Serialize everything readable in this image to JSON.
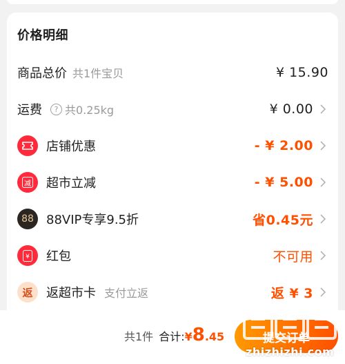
{
  "price_detail": {
    "title": "价格明细",
    "rows": [
      {
        "label": "商品总价",
        "sub": "共1件宝贝",
        "value": "¥ 15.90",
        "value_color": "#1f1f1f",
        "chevron": false,
        "icon": "none"
      },
      {
        "label": "运费",
        "sub": "共0.25kg",
        "help_icon_text": "?",
        "value": "¥ 0.00",
        "value_color": "#1f1f1f",
        "chevron": true,
        "icon": "question-circle-icon"
      },
      {
        "label": "店铺优惠",
        "value": "- ¥ 2.00",
        "value_color": "#ff5000",
        "chevron": true,
        "icon": "ticket-icon"
      },
      {
        "label": "超市立减",
        "icon_text": "减",
        "value": "- ¥ 5.00",
        "value_color": "#ff5000",
        "chevron": true,
        "icon": "discount-badge-icon"
      },
      {
        "label": "88VIP专享9.5折",
        "icon_text": "88",
        "value": "省0.45元",
        "value_color": "#ff5000",
        "chevron": true,
        "icon": "88vip-icon"
      },
      {
        "label": "红包",
        "icon_text": "¥",
        "value": "不可用",
        "value_color": "#ff5000",
        "chevron": true,
        "icon": "red-envelope-icon"
      },
      {
        "label": "返超市卡",
        "sub": "支付立返",
        "icon_text": "返",
        "value": "返 ¥ 3",
        "value_color": "#ff5000",
        "chevron": true,
        "icon": "cashback-icon"
      }
    ]
  },
  "bottom_bar": {
    "count": "共1件",
    "total_label": "合计:",
    "currency": "¥",
    "total_int": "8",
    "total_dec": ".45",
    "submit_label": "提交订单"
  },
  "watermark": {
    "text": "zhizhizhi.com"
  },
  "colors": {
    "accent": "#ff5000",
    "red_icon": "#ff2b3a",
    "background": "#f2f2f2"
  }
}
